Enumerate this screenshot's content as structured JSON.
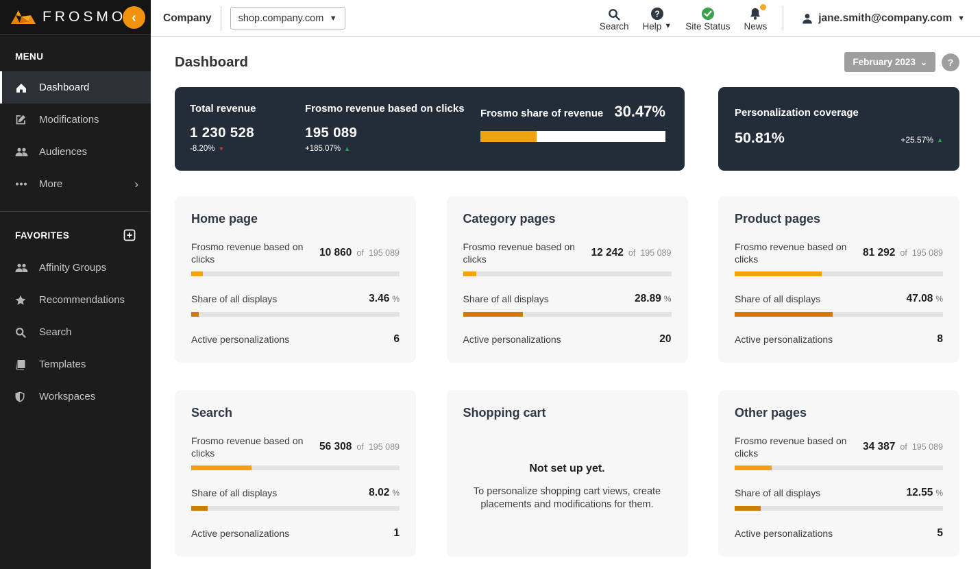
{
  "brand": {
    "name": "FROSMO"
  },
  "topbar": {
    "company_label": "Company",
    "site_domain": "shop.company.com",
    "search_label": "Search",
    "help_label": "Help",
    "status_label": "Site Status",
    "news_label": "News",
    "user_email": "jane.smith@company.com"
  },
  "sidebar": {
    "menu_header": "MENU",
    "items": [
      {
        "label": "Dashboard"
      },
      {
        "label": "Modifications"
      },
      {
        "label": "Audiences"
      },
      {
        "label": "More"
      }
    ],
    "favorites_header": "FAVORITES",
    "favorites": [
      {
        "label": "Affinity Groups"
      },
      {
        "label": "Recommendations"
      },
      {
        "label": "Search"
      },
      {
        "label": "Templates"
      },
      {
        "label": "Workspaces"
      }
    ]
  },
  "page": {
    "title": "Dashboard",
    "period": "February 2023",
    "help_label": "?"
  },
  "summary": {
    "total_revenue": {
      "label": "Total revenue",
      "value": "1 230 528",
      "delta": "-8.20%"
    },
    "frosmo_revenue": {
      "label": "Frosmo revenue based on clicks",
      "value": "195 089",
      "delta": "+185.07%"
    },
    "share_of_revenue": {
      "label": "Frosmo share of revenue",
      "value": "30.47%",
      "percent": 30.47
    },
    "coverage": {
      "label": "Personalization coverage",
      "value": "50.81%",
      "delta": "+25.57%"
    }
  },
  "labels": {
    "revenue_metric": "Frosmo revenue based on clicks",
    "of": "of",
    "revenue_total": "195 089",
    "share_metric": "Share of all displays",
    "percent_unit": "%",
    "active_metric": "Active personalizations"
  },
  "cards": [
    {
      "title": "Home page",
      "revenue": "10 860",
      "revenue_pct": 5.57,
      "share": "3.46",
      "share_pct": 3.46,
      "active": "6"
    },
    {
      "title": "Category pages",
      "revenue": "12 242",
      "revenue_pct": 6.28,
      "share": "28.89",
      "share_pct": 28.89,
      "active": "20"
    },
    {
      "title": "Product pages",
      "revenue": "81 292",
      "revenue_pct": 41.67,
      "share": "47.08",
      "share_pct": 47.08,
      "active": "8"
    },
    {
      "title": "Search",
      "revenue": "56 308",
      "revenue_pct": 28.86,
      "share": "8.02",
      "share_pct": 8.02,
      "active": "1"
    },
    {
      "title": "Shopping cart",
      "empty_title": "Not set up yet.",
      "empty_text": "To personalize shopping cart views, create placements and modifications for them."
    },
    {
      "title": "Other pages",
      "revenue": "34 387",
      "revenue_pct": 17.63,
      "share": "12.55",
      "share_pct": 12.55,
      "active": "5"
    }
  ],
  "colors": {
    "accent": "#f0a30c",
    "accent_dark": "#ce7c05",
    "positive": "#2ea44f",
    "negative": "#c0392b",
    "dark_card": "#232c39"
  }
}
